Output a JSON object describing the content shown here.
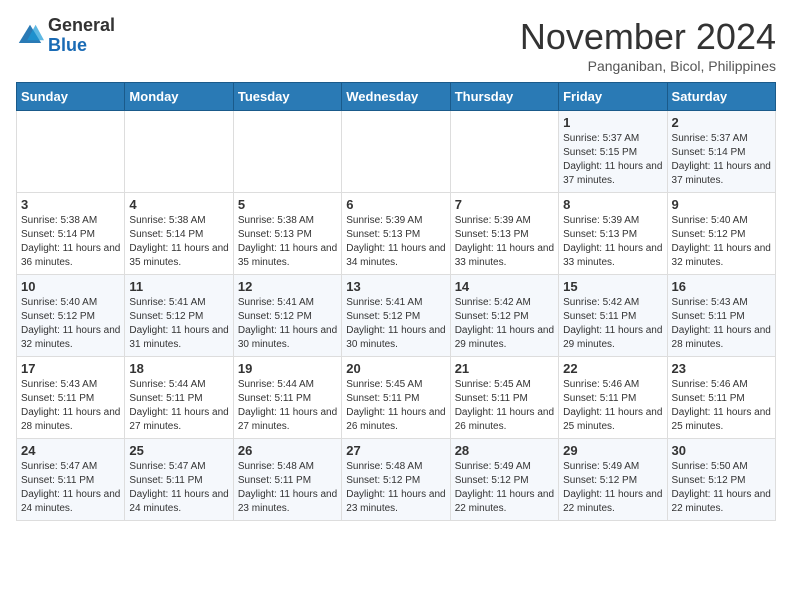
{
  "logo": {
    "text_general": "General",
    "text_blue": "Blue"
  },
  "title": "November 2024",
  "location": "Panganiban, Bicol, Philippines",
  "weekdays": [
    "Sunday",
    "Monday",
    "Tuesday",
    "Wednesday",
    "Thursday",
    "Friday",
    "Saturday"
  ],
  "weeks": [
    [
      {
        "day": "",
        "sunrise": "",
        "sunset": "",
        "daylight": ""
      },
      {
        "day": "",
        "sunrise": "",
        "sunset": "",
        "daylight": ""
      },
      {
        "day": "",
        "sunrise": "",
        "sunset": "",
        "daylight": ""
      },
      {
        "day": "",
        "sunrise": "",
        "sunset": "",
        "daylight": ""
      },
      {
        "day": "",
        "sunrise": "",
        "sunset": "",
        "daylight": ""
      },
      {
        "day": "1",
        "sunrise": "Sunrise: 5:37 AM",
        "sunset": "Sunset: 5:15 PM",
        "daylight": "Daylight: 11 hours and 37 minutes."
      },
      {
        "day": "2",
        "sunrise": "Sunrise: 5:37 AM",
        "sunset": "Sunset: 5:14 PM",
        "daylight": "Daylight: 11 hours and 37 minutes."
      }
    ],
    [
      {
        "day": "3",
        "sunrise": "Sunrise: 5:38 AM",
        "sunset": "Sunset: 5:14 PM",
        "daylight": "Daylight: 11 hours and 36 minutes."
      },
      {
        "day": "4",
        "sunrise": "Sunrise: 5:38 AM",
        "sunset": "Sunset: 5:14 PM",
        "daylight": "Daylight: 11 hours and 35 minutes."
      },
      {
        "day": "5",
        "sunrise": "Sunrise: 5:38 AM",
        "sunset": "Sunset: 5:13 PM",
        "daylight": "Daylight: 11 hours and 35 minutes."
      },
      {
        "day": "6",
        "sunrise": "Sunrise: 5:39 AM",
        "sunset": "Sunset: 5:13 PM",
        "daylight": "Daylight: 11 hours and 34 minutes."
      },
      {
        "day": "7",
        "sunrise": "Sunrise: 5:39 AM",
        "sunset": "Sunset: 5:13 PM",
        "daylight": "Daylight: 11 hours and 33 minutes."
      },
      {
        "day": "8",
        "sunrise": "Sunrise: 5:39 AM",
        "sunset": "Sunset: 5:13 PM",
        "daylight": "Daylight: 11 hours and 33 minutes."
      },
      {
        "day": "9",
        "sunrise": "Sunrise: 5:40 AM",
        "sunset": "Sunset: 5:12 PM",
        "daylight": "Daylight: 11 hours and 32 minutes."
      }
    ],
    [
      {
        "day": "10",
        "sunrise": "Sunrise: 5:40 AM",
        "sunset": "Sunset: 5:12 PM",
        "daylight": "Daylight: 11 hours and 32 minutes."
      },
      {
        "day": "11",
        "sunrise": "Sunrise: 5:41 AM",
        "sunset": "Sunset: 5:12 PM",
        "daylight": "Daylight: 11 hours and 31 minutes."
      },
      {
        "day": "12",
        "sunrise": "Sunrise: 5:41 AM",
        "sunset": "Sunset: 5:12 PM",
        "daylight": "Daylight: 11 hours and 30 minutes."
      },
      {
        "day": "13",
        "sunrise": "Sunrise: 5:41 AM",
        "sunset": "Sunset: 5:12 PM",
        "daylight": "Daylight: 11 hours and 30 minutes."
      },
      {
        "day": "14",
        "sunrise": "Sunrise: 5:42 AM",
        "sunset": "Sunset: 5:12 PM",
        "daylight": "Daylight: 11 hours and 29 minutes."
      },
      {
        "day": "15",
        "sunrise": "Sunrise: 5:42 AM",
        "sunset": "Sunset: 5:11 PM",
        "daylight": "Daylight: 11 hours and 29 minutes."
      },
      {
        "day": "16",
        "sunrise": "Sunrise: 5:43 AM",
        "sunset": "Sunset: 5:11 PM",
        "daylight": "Daylight: 11 hours and 28 minutes."
      }
    ],
    [
      {
        "day": "17",
        "sunrise": "Sunrise: 5:43 AM",
        "sunset": "Sunset: 5:11 PM",
        "daylight": "Daylight: 11 hours and 28 minutes."
      },
      {
        "day": "18",
        "sunrise": "Sunrise: 5:44 AM",
        "sunset": "Sunset: 5:11 PM",
        "daylight": "Daylight: 11 hours and 27 minutes."
      },
      {
        "day": "19",
        "sunrise": "Sunrise: 5:44 AM",
        "sunset": "Sunset: 5:11 PM",
        "daylight": "Daylight: 11 hours and 27 minutes."
      },
      {
        "day": "20",
        "sunrise": "Sunrise: 5:45 AM",
        "sunset": "Sunset: 5:11 PM",
        "daylight": "Daylight: 11 hours and 26 minutes."
      },
      {
        "day": "21",
        "sunrise": "Sunrise: 5:45 AM",
        "sunset": "Sunset: 5:11 PM",
        "daylight": "Daylight: 11 hours and 26 minutes."
      },
      {
        "day": "22",
        "sunrise": "Sunrise: 5:46 AM",
        "sunset": "Sunset: 5:11 PM",
        "daylight": "Daylight: 11 hours and 25 minutes."
      },
      {
        "day": "23",
        "sunrise": "Sunrise: 5:46 AM",
        "sunset": "Sunset: 5:11 PM",
        "daylight": "Daylight: 11 hours and 25 minutes."
      }
    ],
    [
      {
        "day": "24",
        "sunrise": "Sunrise: 5:47 AM",
        "sunset": "Sunset: 5:11 PM",
        "daylight": "Daylight: 11 hours and 24 minutes."
      },
      {
        "day": "25",
        "sunrise": "Sunrise: 5:47 AM",
        "sunset": "Sunset: 5:11 PM",
        "daylight": "Daylight: 11 hours and 24 minutes."
      },
      {
        "day": "26",
        "sunrise": "Sunrise: 5:48 AM",
        "sunset": "Sunset: 5:11 PM",
        "daylight": "Daylight: 11 hours and 23 minutes."
      },
      {
        "day": "27",
        "sunrise": "Sunrise: 5:48 AM",
        "sunset": "Sunset: 5:12 PM",
        "daylight": "Daylight: 11 hours and 23 minutes."
      },
      {
        "day": "28",
        "sunrise": "Sunrise: 5:49 AM",
        "sunset": "Sunset: 5:12 PM",
        "daylight": "Daylight: 11 hours and 22 minutes."
      },
      {
        "day": "29",
        "sunrise": "Sunrise: 5:49 AM",
        "sunset": "Sunset: 5:12 PM",
        "daylight": "Daylight: 11 hours and 22 minutes."
      },
      {
        "day": "30",
        "sunrise": "Sunrise: 5:50 AM",
        "sunset": "Sunset: 5:12 PM",
        "daylight": "Daylight: 11 hours and 22 minutes."
      }
    ]
  ]
}
